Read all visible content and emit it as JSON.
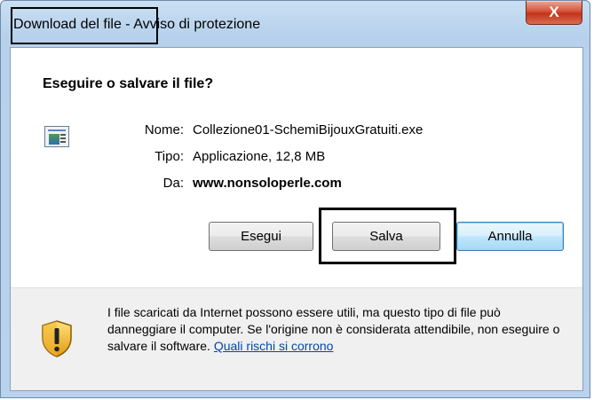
{
  "window": {
    "title_part1": "Download del file",
    "title_part2": " - Avviso di protezione",
    "close_label": "X"
  },
  "dialog": {
    "heading": "Eseguire o salvare il file?",
    "file_icon": "application-file-icon",
    "fields": {
      "name_label": "Nome:",
      "name_value": "Collezione01-SchemiBijouxGratuiti.exe",
      "type_label": "Tipo:",
      "type_value": "Applicazione, 12,8 MB",
      "from_label": "Da:",
      "from_value": "www.nonsoloperle.com"
    },
    "buttons": {
      "run": "Esegui",
      "save": "Salva",
      "cancel": "Annulla"
    }
  },
  "warning": {
    "icon": "security-shield-icon",
    "text": "I file scaricati da Internet possono essere utili, ma questo tipo di file può danneggiare il computer. Se l'origine non è considerata attendibile, non eseguire o salvare il software. ",
    "link": "Quali rischi si corrono"
  },
  "colors": {
    "close_red": "#c4321b",
    "default_button_border": "#3c7fb1",
    "link_blue": "#0645ad"
  }
}
